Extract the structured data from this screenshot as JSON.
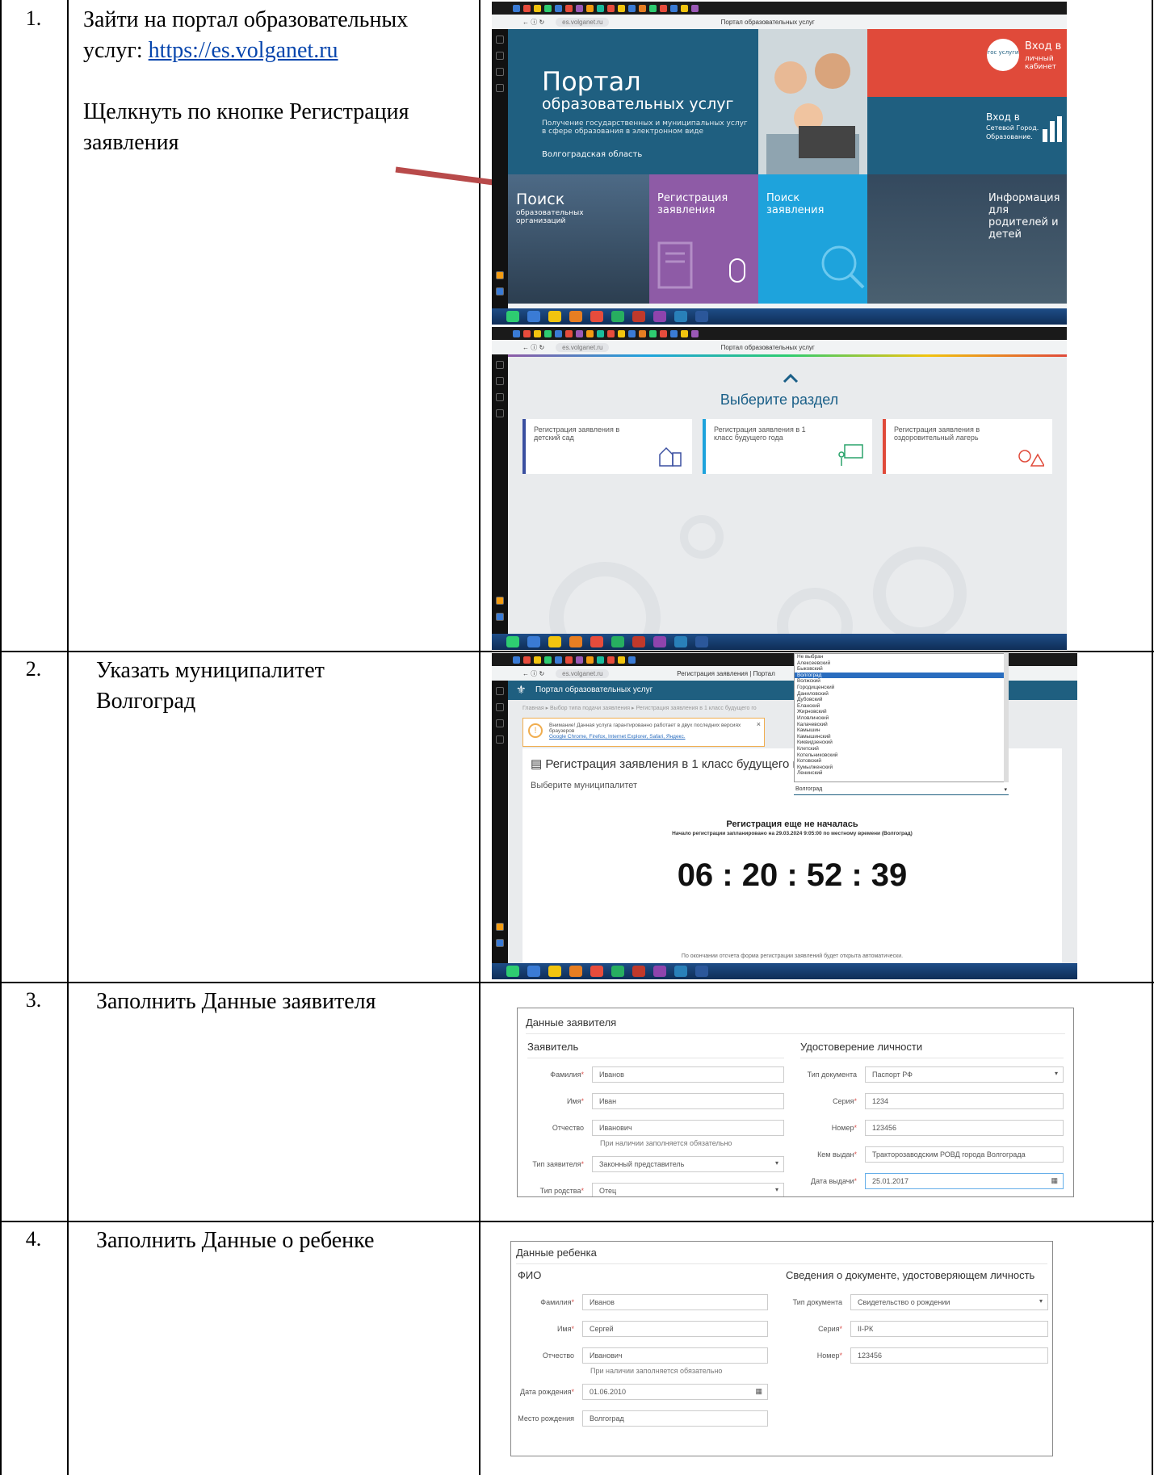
{
  "steps": [
    {
      "num": "1.",
      "lines": [
        "Зайти на портал образовательных",
        "услуг: "
      ],
      "link": "https://es.volganet.ru",
      "extra": [
        "Щелкнуть по кнопке Регистрация",
        "заявления"
      ]
    },
    {
      "num": "2.",
      "lines": [
        "Указать муниципалитет",
        "Волгоград"
      ]
    },
    {
      "num": "3.",
      "lines": [
        "Заполнить Данные заявителя"
      ]
    },
    {
      "num": "4.",
      "lines": [
        "Заполнить Данные о ребенке"
      ]
    }
  ],
  "browser": {
    "url": "es.volganet.ru",
    "title1": "Портал образовательных услуг",
    "title3": "Регистрация заявления | Портал"
  },
  "portal": {
    "hero_title": "Портал",
    "hero_sub": "образовательных услуг",
    "hero_desc": "Получение государственных и муниципальных услуг в сфере образования в электронном виде",
    "region": "Волгоградская область",
    "gos_logo": "гос услуги",
    "login1": [
      "Вход в",
      "личный кабинет"
    ],
    "login2": [
      "Вход в",
      "Сетевой Город.",
      "Образование."
    ],
    "tiles": [
      {
        "title": "Поиск",
        "sub": "образовательных организаций"
      },
      {
        "title": "Регистрация",
        "sub": "заявления"
      },
      {
        "title": "Поиск",
        "sub": "заявления"
      },
      {
        "title": "Информация",
        "sub": "для родителей и детей"
      }
    ]
  },
  "section": {
    "heading": "Выберите раздел",
    "cards": [
      "Регистрация заявления в детский сад",
      "Регистрация заявления в 1 класс будущего года",
      "Регистрация заявления в оздоровительный лагерь"
    ]
  },
  "reg": {
    "brand": "Портал образовательных услуг",
    "breadcrumb": "Главная ▸ Выбор типа подачи заявления ▸ Регистрация заявления в 1 класс будущего го",
    "notice": "Внимание! Данная услуга гарантированно работает в двух последних версиях браузеров",
    "notice_links": "Google Chrome, Firefox, Internet Explorer, Safari, Яндекс.",
    "title": "Регистрация заявления в 1 класс будущего год",
    "muni_label": "Выберите муниципалитет",
    "selected": "Волгоград",
    "options": [
      "Не выбран",
      "Алексеевский",
      "Быковский",
      "Волгоград",
      "Волжский",
      "Городищенский",
      "Даниловский",
      "Дубовский",
      "Еланский",
      "Жирновский",
      "Иловлинский",
      "Калачевский",
      "Камышин",
      "Камышинский",
      "Киквидзенский",
      "Клетский",
      "Котельниковский",
      "Котовский",
      "Кумылженский",
      "Ленинский"
    ],
    "not_started": "Регистрация еще не началась",
    "start_info": "Начало регистрации запланировано на 29.03.2024 9:05:00 по местному времени (Волгоград)",
    "timer": "06 : 20 : 52 : 39",
    "footer_note": "По окончании отсчета форма регистрации заявлений будет открыта автоматически."
  },
  "applicant": {
    "title": "Данные заявителя",
    "left_title": "Заявитель",
    "right_title": "Удостоверение личности",
    "surname_l": "Фамилия",
    "surname": "Иванов",
    "name_l": "Имя",
    "name": "Иван",
    "patr_l": "Отчество",
    "patr": "Иванович",
    "hint": "При наличии заполняется обязательно",
    "type_l": "Тип заявителя",
    "type": "Законный представитель",
    "kin_l": "Тип родства",
    "kin": "Отец",
    "doc_l": "Тип документа",
    "doc": "Паспорт РФ",
    "ser_l": "Серия",
    "ser": "1234",
    "numb_l": "Номер",
    "numb": "123456",
    "issued_l": "Кем выдан",
    "issued": "Тракторозаводским РОВД города Волгограда",
    "date_l": "Дата выдачи",
    "date": "25.01.2017"
  },
  "child": {
    "title": "Данные ребенка",
    "left_title": "ФИО",
    "right_title": "Сведения о документе, удостоверяющем личность",
    "surname_l": "Фамилия",
    "surname": "Иванов",
    "name_l": "Имя",
    "name": "Сергей",
    "patr_l": "Отчество",
    "patr": "Иванович",
    "hint": "При наличии заполняется обязательно",
    "birth_l": "Дата рождения",
    "birth": "01.06.2010",
    "place_l": "Место рождения",
    "place": "Волгоград",
    "doc_l": "Тип документа",
    "doc": "Свидетельство о рождении",
    "ser_l": "Серия",
    "ser": "II-РК",
    "numb_l": "Номер",
    "numb": "123456"
  },
  "colors": {
    "hero": "#1f5f80",
    "purple": "#8e5ba6",
    "cyan": "#1ea3dc",
    "red": "#e04a3a",
    "arrow": "#b84a4a"
  }
}
